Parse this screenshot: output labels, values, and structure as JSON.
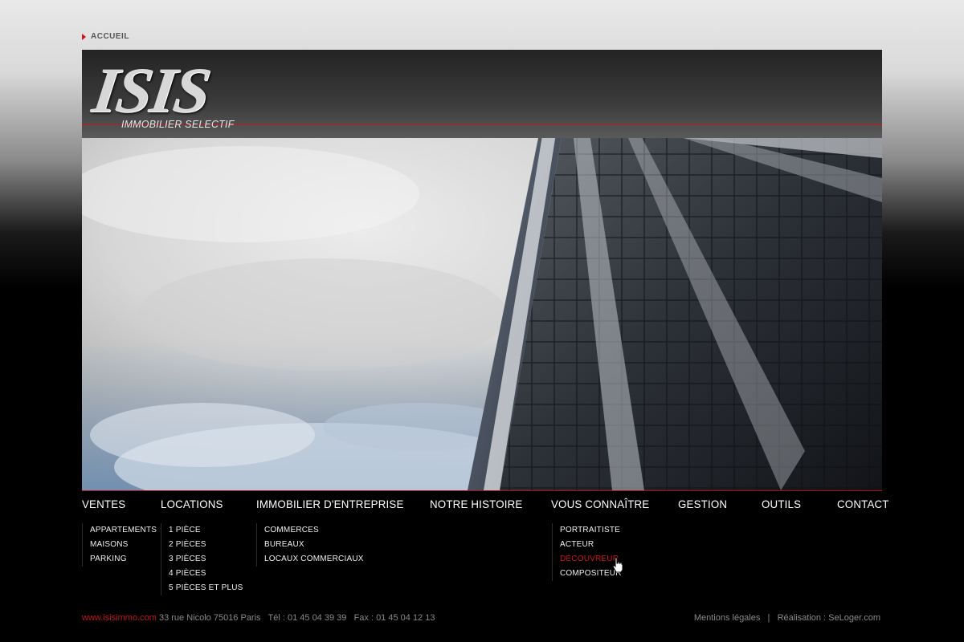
{
  "breadcrumb": {
    "label": "ACCUEIL"
  },
  "logo": {
    "name": "ISIS",
    "tagline": "IMMOBILIER SELECTIF"
  },
  "colors": {
    "accent": "#d0121b",
    "background_top": "#e4e4e4",
    "background_bottom": "#000000"
  },
  "nav": [
    {
      "label": "VENTES"
    },
    {
      "label": "LOCATIONS"
    },
    {
      "label": "IMMOBILIER D'ENTREPRISE"
    },
    {
      "label": "NOTRE HISTOIRE"
    },
    {
      "label": "VOUS CONNAÎTRE"
    },
    {
      "label": "GESTION"
    },
    {
      "label": "OUTILS"
    },
    {
      "label": "CONTACT"
    }
  ],
  "submenus": {
    "ventes": [
      "APPARTEMENTS",
      "MAISONS",
      "PARKING"
    ],
    "locations": [
      "1 PIÈCE",
      "2 PIÈCES",
      "3 PIÈCES",
      "4 PIÈCES",
      "5 PIÈCES ET PLUS"
    ],
    "entreprise": [
      "COMMERCES",
      "BUREAUX",
      "LOCAUX COMMERCIAUX"
    ],
    "connaitre": [
      "PORTRAITISTE",
      "ACTEUR",
      "DÉCOUVREUR",
      "COMPOSITEUR"
    ]
  },
  "active_submenu_item": "DÉCOUVREUR",
  "footer": {
    "website": "www.isisimmo.com",
    "address": "33 rue Nicolo 75016 Paris",
    "phone": "Tél : 01 45 04 39 39",
    "fax": "Fax : 01 45 04 12 13",
    "legal": "Mentions légales",
    "separator": "|",
    "credit": "Réalisation : SeLoger.com"
  }
}
